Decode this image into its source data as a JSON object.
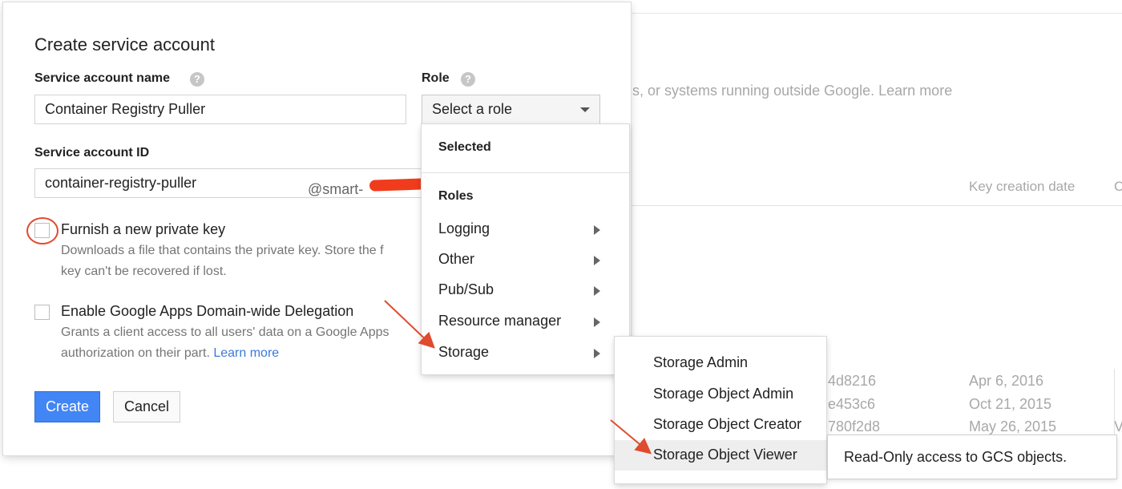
{
  "background": {
    "description_fragment": "s, or systems running outside Google. Learn more",
    "col_key_creation_date": "Key creation date",
    "col_c": "C",
    "rows": [
      {
        "id": "4d8216",
        "date": "Apr 6, 2016"
      },
      {
        "id": "e453c6",
        "date": "Oct 21, 2015"
      },
      {
        "id": "780f2d8",
        "date": "May 26, 2015",
        "extra": "V"
      }
    ]
  },
  "dialog": {
    "title": "Create service account",
    "name_label": "Service account name",
    "name_value": "Container Registry Puller",
    "role_label": "Role",
    "role_select": "Select a role",
    "id_label": "Service account ID",
    "id_value": "container-registry-puller",
    "id_domain": "@smart-",
    "furnish_title": "Furnish a new private key",
    "furnish_desc_1": "Downloads a file that contains the private key. Store the f",
    "furnish_desc_2": "key can't be recovered if lost.",
    "delegation_title": "Enable Google Apps Domain-wide Delegation",
    "delegation_desc_1": "Grants a client access to all users' data on a Google Apps",
    "delegation_desc_2": "authorization on their part.",
    "learn_more": "Learn more",
    "create_button": "Create",
    "cancel_button": "Cancel"
  },
  "role_menu": {
    "selected_header": "Selected",
    "roles_header": "Roles",
    "items": [
      "Logging",
      "Other",
      "Pub/Sub",
      "Resource manager",
      "Storage"
    ]
  },
  "storage_submenu": {
    "items": [
      "Storage Admin",
      "Storage Object Admin",
      "Storage Object Creator",
      "Storage Object Viewer"
    ],
    "highlighted": "Storage Object Viewer"
  },
  "tooltip": "Read-Only access to GCS objects.",
  "colors": {
    "primary_button": "#4285f4",
    "link": "#3d79d8",
    "annotation": "#e04a2e"
  }
}
